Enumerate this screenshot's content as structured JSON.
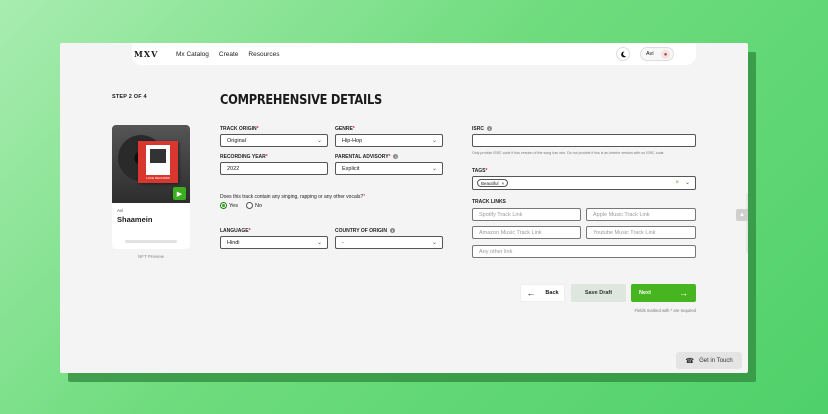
{
  "nav": {
    "logo": "MXV",
    "links": [
      "Mx Catalog",
      "Create",
      "Resources"
    ],
    "theme_icon": "moon-icon",
    "user_name": "Avi",
    "user_icon": "avatar-icon"
  },
  "step": "STEP 2 OF 4",
  "title": "COMPREHENSIVE DETAILS",
  "preview": {
    "artist": "Avi",
    "track": "Shaamein",
    "cover_text": "LOVE RECORDS",
    "label": "NFT Preview",
    "play_icon": "play-icon"
  },
  "form": {
    "track_origin": {
      "label": "TRACK ORIGIN",
      "value": "Original"
    },
    "genre": {
      "label": "GENRE",
      "value": "Hip-Hop"
    },
    "recording_year": {
      "label": "RECORDING YEAR",
      "value": "2022"
    },
    "parental_advisory": {
      "label": "PARENTAL ADVISORY",
      "value": "Explicit"
    },
    "vocals_question": "Does this track contain any singing, rapping or any other vocals?",
    "vocals_options": [
      "Yes",
      "No"
    ],
    "vocals_selected": "Yes",
    "language": {
      "label": "LANGUAGE",
      "value": "Hindi"
    },
    "country": {
      "label": "COUNTRY OF ORIGIN",
      "value": "-"
    },
    "isrc": {
      "label": "ISRC",
      "value": "",
      "help": "Only provide ISRC code if this version of the song has one. Do not provide if this is an interim version with no ISRC code."
    },
    "tags": {
      "label": "TAGS",
      "chips": [
        "Beautiful"
      ]
    },
    "track_links": {
      "label": "TRACK LINKS",
      "spotify": "Spotify Track Link",
      "apple": "Apple Music Track Link",
      "amazon": "Amazon Music Track Link",
      "youtube": "Youtube Music Track Link",
      "other": "Any other link"
    }
  },
  "actions": {
    "back": "Back",
    "save_draft": "Save Draft",
    "next": "Next",
    "footnote": "Fields marked with * are required"
  },
  "support": {
    "label": "Get in Touch",
    "icon": "headset-icon"
  },
  "colors": {
    "accent": "#47b51f",
    "required": "#dd2233"
  }
}
